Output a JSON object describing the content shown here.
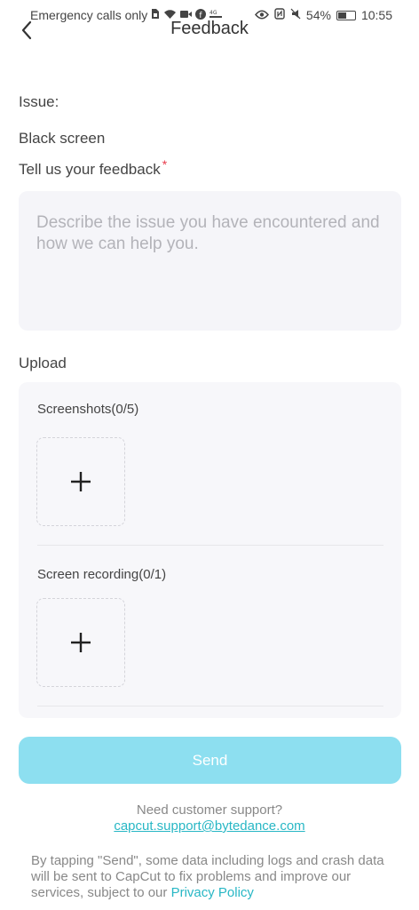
{
  "status_bar": {
    "carrier_text": "Emergency calls only",
    "battery_percent": "54%",
    "battery_level": 0.54,
    "time": "10:55",
    "icons": [
      "sim-icon",
      "wifi-icon",
      "video-icon",
      "facebook-icon",
      "data-icon",
      "eye-icon",
      "nfc-icon",
      "mute-icon",
      "battery-icon"
    ]
  },
  "header": {
    "title": "Feedback",
    "back_icon": "chevron-left-icon"
  },
  "issue": {
    "label": "Issue:",
    "value": "Black screen"
  },
  "feedback": {
    "label": "Tell us your feedback",
    "required_marker": "*",
    "placeholder": "Describe the issue you have encountered and how we can help you.",
    "value": ""
  },
  "upload": {
    "label": "Upload",
    "screenshots_label": "Screenshots(0/5)",
    "recording_label": "Screen recording(0/1)",
    "add_icon": "plus-icon"
  },
  "send_button": {
    "label": "Send",
    "color": "#8ddff0"
  },
  "support": {
    "prompt": "Need customer support?",
    "email": "capcut.support@bytedance.com"
  },
  "disclaimer": {
    "text": "By tapping \"Send\", some data including logs and crash data will be sent to CapCut to fix problems and improve our services, subject to our ",
    "link_label": "Privacy Policy",
    "link_color": "#28b7c5"
  }
}
